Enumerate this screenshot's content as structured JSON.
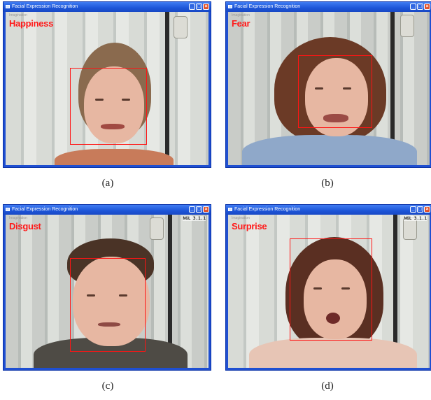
{
  "panels": [
    {
      "id": "a",
      "window_title": "Facial Expression Recognition",
      "brand": "Imagination",
      "emotion": "Happiness",
      "version": "",
      "caption": "(a)"
    },
    {
      "id": "b",
      "window_title": "Facial Expression Recognition",
      "brand": "Imagination",
      "emotion": "Fear",
      "version": "",
      "caption": "(b)"
    },
    {
      "id": "c",
      "window_title": "Facial Expression Recognition",
      "brand": "Imagination",
      "emotion": "Disgust",
      "version": "NGL 3.1.1",
      "caption": "(c)"
    },
    {
      "id": "d",
      "window_title": "Facial Expression Recognition",
      "brand": "Imagination",
      "emotion": "Surprise",
      "version": "NGL 3.1.1",
      "caption": "(d)"
    }
  ],
  "colors": {
    "titlebar": "#1d55d8",
    "emotion_text": "#ff1a1a",
    "face_box": "#ff1414",
    "close_button": "#e0502a"
  },
  "icons": [
    "app-icon",
    "minimize-icon",
    "maximize-icon",
    "close-icon"
  ]
}
